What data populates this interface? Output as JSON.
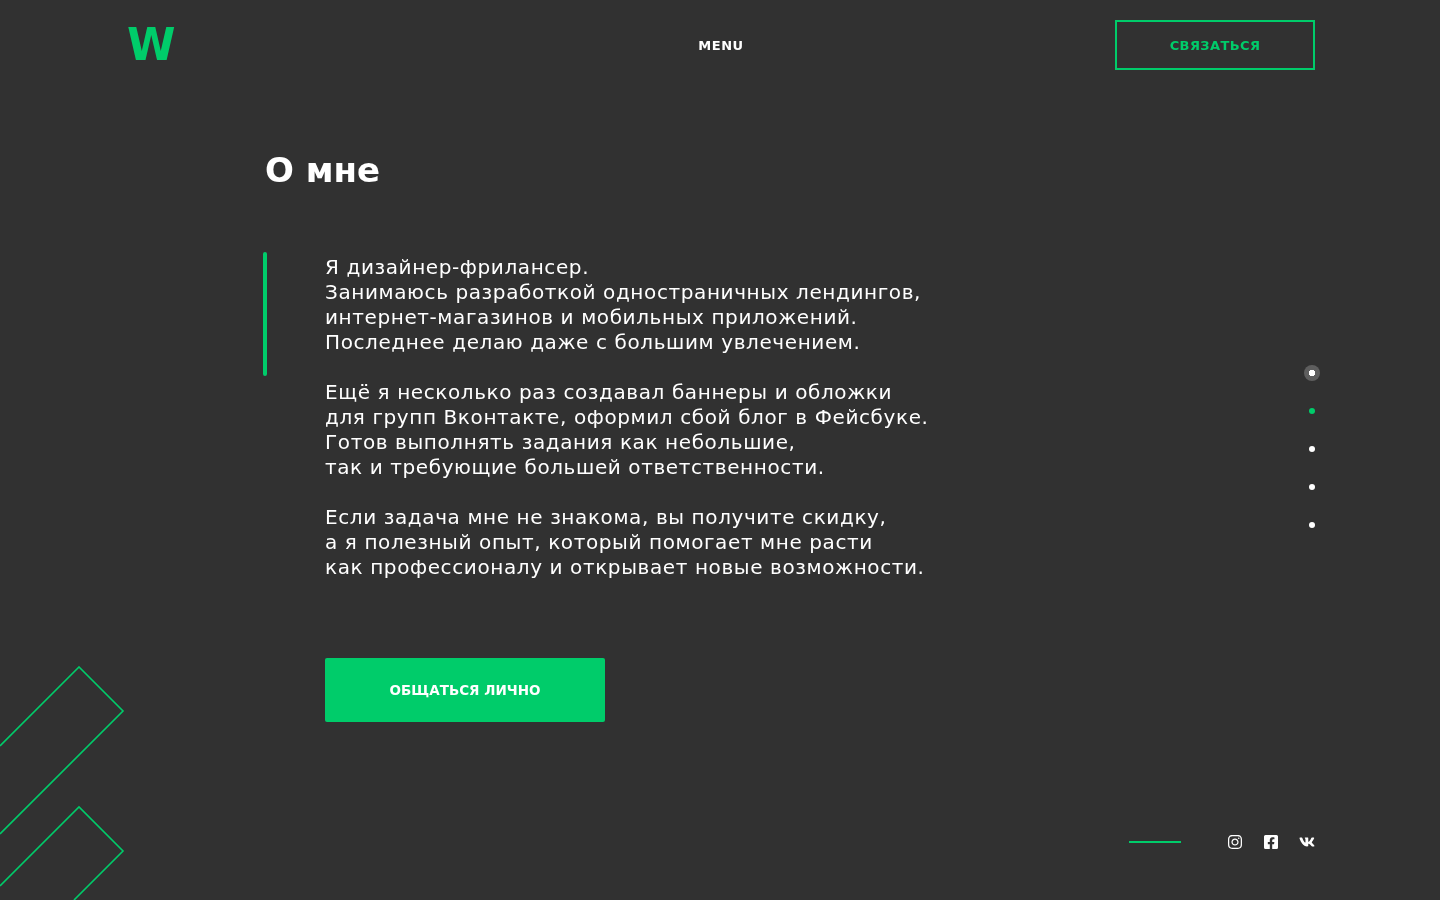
{
  "header": {
    "logo": "W",
    "menu": "MENU",
    "contact_button": "СВЯЗАТЬСЯ"
  },
  "section": {
    "title": "О мне",
    "paragraphs": [
      {
        "accent": true,
        "lines": [
          "Я дизайнер-фрилансер.",
          "Занимаюсь разработкой одностраничных лендингов,",
          "интернет-магазинов и мобильных приложений.",
          "Последнее делаю даже с большим увлечением."
        ]
      },
      {
        "accent": false,
        "lines": [
          "Ещё я несколько раз создавал баннеры и обложки",
          "для групп Вконтакте, оформил сбой блог в Фейсбуке.",
          "Готов выполнять задания как небольшие,",
          "так и требующие большей ответственности."
        ]
      },
      {
        "accent": false,
        "lines": [
          "Если задача мне не знакома, вы получите скидку,",
          "а я полезный опыт, который помогает мне расти",
          "как профессионалу и открывает новые возможности."
        ]
      }
    ],
    "button": "ОБЩАТЬСЯ ЛИЧНО"
  },
  "nav_dots": [
    {
      "selected": false,
      "hovered": true
    },
    {
      "selected": true,
      "hovered": false
    },
    {
      "selected": false,
      "hovered": false
    },
    {
      "selected": false,
      "hovered": false
    },
    {
      "selected": false,
      "hovered": false
    }
  ],
  "social_links": [
    {
      "kind": "instagram"
    },
    {
      "kind": "facebook"
    },
    {
      "kind": "vk"
    }
  ]
}
